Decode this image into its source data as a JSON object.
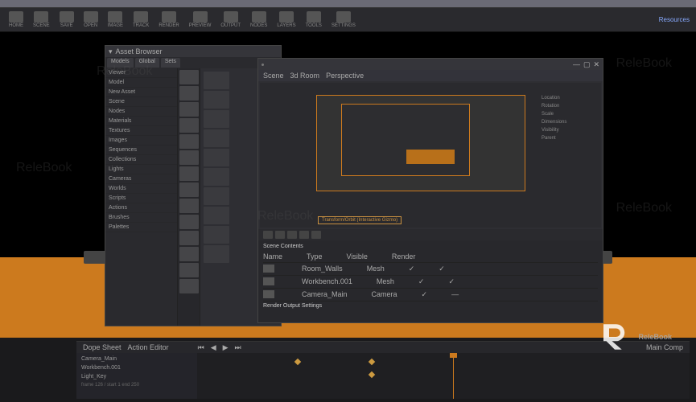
{
  "app": {
    "menu_hint": "Resources"
  },
  "toolbar": {
    "items": [
      {
        "label": "HOME"
      },
      {
        "label": "SCENE"
      },
      {
        "label": "SAVE"
      },
      {
        "label": "OPEN"
      },
      {
        "label": "IMAGE"
      },
      {
        "label": "TRACK"
      },
      {
        "label": "RENDER"
      },
      {
        "label": "PREVIEW"
      },
      {
        "label": "OUTPUT"
      },
      {
        "label": "NODES"
      },
      {
        "label": "LAYERS"
      },
      {
        "label": "TOOLS"
      },
      {
        "label": "SETTINGS"
      }
    ]
  },
  "panel_left": {
    "title": "Asset Browser",
    "tabs": [
      "Models",
      "Global",
      "Sets"
    ],
    "tree": [
      "Viewer",
      "Model",
      "New Asset",
      "Scene",
      "Nodes",
      "Materials",
      "Textures",
      "Images",
      "Sequences",
      "Collections",
      "Lights",
      "Cameras",
      "Worlds",
      "Scripts",
      "Actions",
      "Brushes",
      "Palettes"
    ]
  },
  "panel_center": {
    "breadcrumb": [
      "Scene",
      "3d Room",
      "Perspective"
    ],
    "viewport_caption": "Transform/Orbit (Interactive Gizmo)",
    "props": [
      "Location",
      "Rotation",
      "Scale",
      "Dimensions",
      "Visibility",
      "Parent"
    ],
    "list_section": "Scene Contents",
    "list_headers": [
      "Name",
      "Type",
      "Visible",
      "Render"
    ],
    "rows": [
      {
        "name": "Room_Walls",
        "type": "Mesh",
        "vis": "✓",
        "ren": "✓"
      },
      {
        "name": "Workbench.001",
        "type": "Mesh",
        "vis": "✓",
        "ren": "✓"
      },
      {
        "name": "Camera_Main",
        "type": "Camera",
        "vis": "✓",
        "ren": "—"
      }
    ],
    "footer_caption": "Render Output Settings"
  },
  "bottom": {
    "tabs": [
      "Dope Sheet",
      "Action Editor"
    ],
    "project_label": "Main Comp",
    "tracks": [
      {
        "name": "Camera_Main"
      },
      {
        "name": "Workbench.001"
      },
      {
        "name": "Light_Key"
      }
    ],
    "transport": [
      "⏮",
      "◀",
      "▶",
      "⏭"
    ],
    "frame_display": "frame 126 / start 1 end 250"
  },
  "watermark": "ReleBook"
}
